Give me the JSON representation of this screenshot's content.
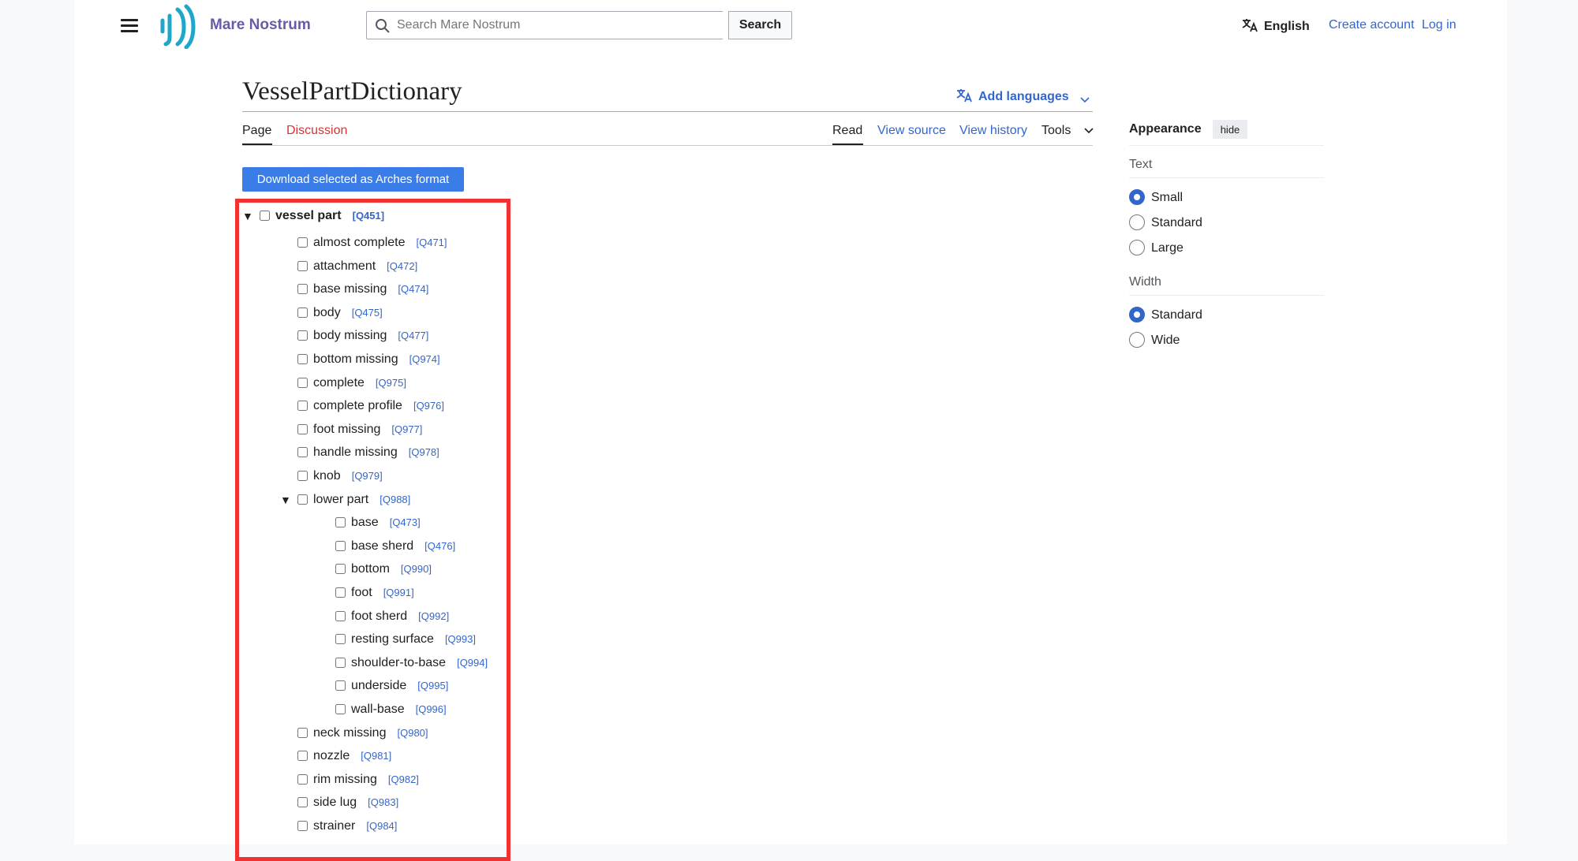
{
  "header": {
    "site_name": "Mare Nostrum",
    "search_placeholder": "Search Mare Nostrum",
    "search_button": "Search",
    "language": "English",
    "create_account": "Create account",
    "log_in": "Log in"
  },
  "page": {
    "title": "VesselPartDictionary",
    "add_languages": "Add languages"
  },
  "tabs": {
    "page": "Page",
    "discussion": "Discussion",
    "read": "Read",
    "view_source": "View source",
    "view_history": "View history",
    "tools": "Tools"
  },
  "download_button": "Download selected as Arches format",
  "tree": {
    "root": {
      "label": "vessel part",
      "qid": "[Q451]"
    },
    "items": [
      {
        "label": "almost complete",
        "qid": "[Q471]"
      },
      {
        "label": "attachment",
        "qid": "[Q472]"
      },
      {
        "label": "base missing",
        "qid": "[Q474]"
      },
      {
        "label": "body",
        "qid": "[Q475]"
      },
      {
        "label": "body missing",
        "qid": "[Q477]"
      },
      {
        "label": "bottom missing",
        "qid": "[Q974]"
      },
      {
        "label": "complete",
        "qid": "[Q975]"
      },
      {
        "label": "complete profile",
        "qid": "[Q976]"
      },
      {
        "label": "foot missing",
        "qid": "[Q977]"
      },
      {
        "label": "handle missing",
        "qid": "[Q978]"
      },
      {
        "label": "knob",
        "qid": "[Q979]"
      },
      {
        "label": "lower part",
        "qid": "[Q988]"
      }
    ],
    "lower_part_children": [
      {
        "label": "base",
        "qid": "[Q473]"
      },
      {
        "label": "base sherd",
        "qid": "[Q476]"
      },
      {
        "label": "bottom",
        "qid": "[Q990]"
      },
      {
        "label": "foot",
        "qid": "[Q991]"
      },
      {
        "label": "foot sherd",
        "qid": "[Q992]"
      },
      {
        "label": "resting surface",
        "qid": "[Q993]"
      },
      {
        "label": "shoulder-to-base",
        "qid": "[Q994]"
      },
      {
        "label": "underside",
        "qid": "[Q995]"
      },
      {
        "label": "wall-base",
        "qid": "[Q996]"
      }
    ],
    "items_after": [
      {
        "label": "neck missing",
        "qid": "[Q980]"
      },
      {
        "label": "nozzle",
        "qid": "[Q981]"
      },
      {
        "label": "rim missing",
        "qid": "[Q982]"
      },
      {
        "label": "side lug",
        "qid": "[Q983]"
      },
      {
        "label": "strainer",
        "qid": "[Q984]"
      }
    ]
  },
  "appearance": {
    "title": "Appearance",
    "hide": "hide",
    "text_heading": "Text",
    "text_options": [
      "Small",
      "Standard",
      "Large"
    ],
    "text_selected": "Small",
    "width_heading": "Width",
    "width_options": [
      "Standard",
      "Wide"
    ],
    "width_selected": "Standard"
  },
  "colors": {
    "link": "#3366cc",
    "discussion": "#d73333",
    "download_button": "#3a7de9",
    "highlight_box": "#f03232",
    "site_name": "#6a5ba8"
  }
}
